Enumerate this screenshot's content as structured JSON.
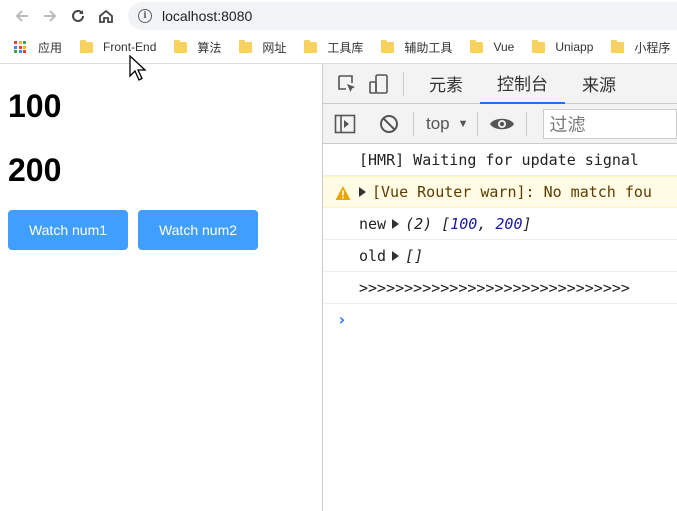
{
  "browser": {
    "url": "localhost:8080",
    "bookmarks": [
      {
        "label": "应用",
        "type": "apps"
      },
      {
        "label": "Front-End",
        "type": "folder"
      },
      {
        "label": "算法",
        "type": "folder"
      },
      {
        "label": "网址",
        "type": "folder"
      },
      {
        "label": "工具库",
        "type": "folder"
      },
      {
        "label": "辅助工具",
        "type": "folder"
      },
      {
        "label": "Vue",
        "type": "folder"
      },
      {
        "label": "Uniapp",
        "type": "folder"
      },
      {
        "label": "小程序",
        "type": "folder"
      }
    ]
  },
  "page": {
    "num1": "100",
    "num2": "200",
    "watch_num1_label": "Watch num1",
    "watch_num2_label": "Watch num2",
    "button_color": "#409eff"
  },
  "devtools": {
    "tabs": [
      "元素",
      "控制台",
      "来源"
    ],
    "active_tab": "控制台",
    "context": "top",
    "filter_placeholder": "过滤",
    "console": {
      "hmr": "[HMR] Waiting for update signal",
      "warn": "[Vue Router warn]: No match fou",
      "new_label": "new",
      "new_count": "(2)",
      "new_values": [
        "100",
        "200"
      ],
      "old_label": "old",
      "old_value": "[]",
      "separator": ">>>>>>>>>>>>>>>>>>>>>>>>>>>>>>",
      "prompt": "›"
    }
  }
}
